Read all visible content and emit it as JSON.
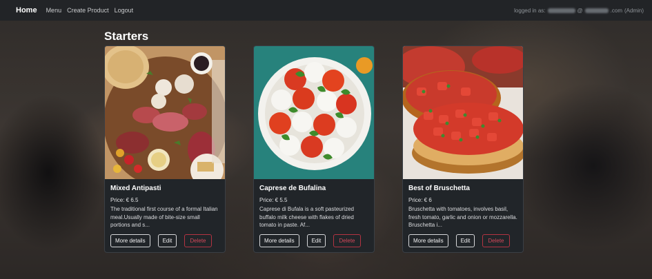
{
  "nav": {
    "brand": "Home",
    "links": [
      "Menu",
      "Create Product",
      "Logout"
    ],
    "login_prefix": "logged in as:",
    "login_at": "@",
    "login_domain_suffix": ".com",
    "login_role": "(Admin)"
  },
  "section_title": "Starters",
  "cards": [
    {
      "title": "Mixed Antipasti",
      "price": "Price: € 6.5",
      "description": "The traditional first course of a formal Italian meal.Usually made of bite-size small portions and s...",
      "details_label": "More details",
      "edit_label": "Edit",
      "delete_label": "Delete"
    },
    {
      "title": "Caprese de Bufalina",
      "price": "Price: € 5.5",
      "description": "Caprese di Bufala is a soft pasteurized buffalo milk cheese with flakes of dried tomato in paste. Af...",
      "details_label": "More details",
      "edit_label": "Edit",
      "delete_label": "Delete"
    },
    {
      "title": "Best of Bruschetta",
      "price": "Price: € 6",
      "description": "Bruschetta with tomatoes, involves basil, fresh tomato, garlic and onion or mozzarella. Bruschetta i...",
      "details_label": "More details",
      "edit_label": "Edit",
      "delete_label": "Delete"
    }
  ],
  "colors": {
    "navbar": "#222427",
    "card": "#212529",
    "danger": "#d2485a"
  }
}
